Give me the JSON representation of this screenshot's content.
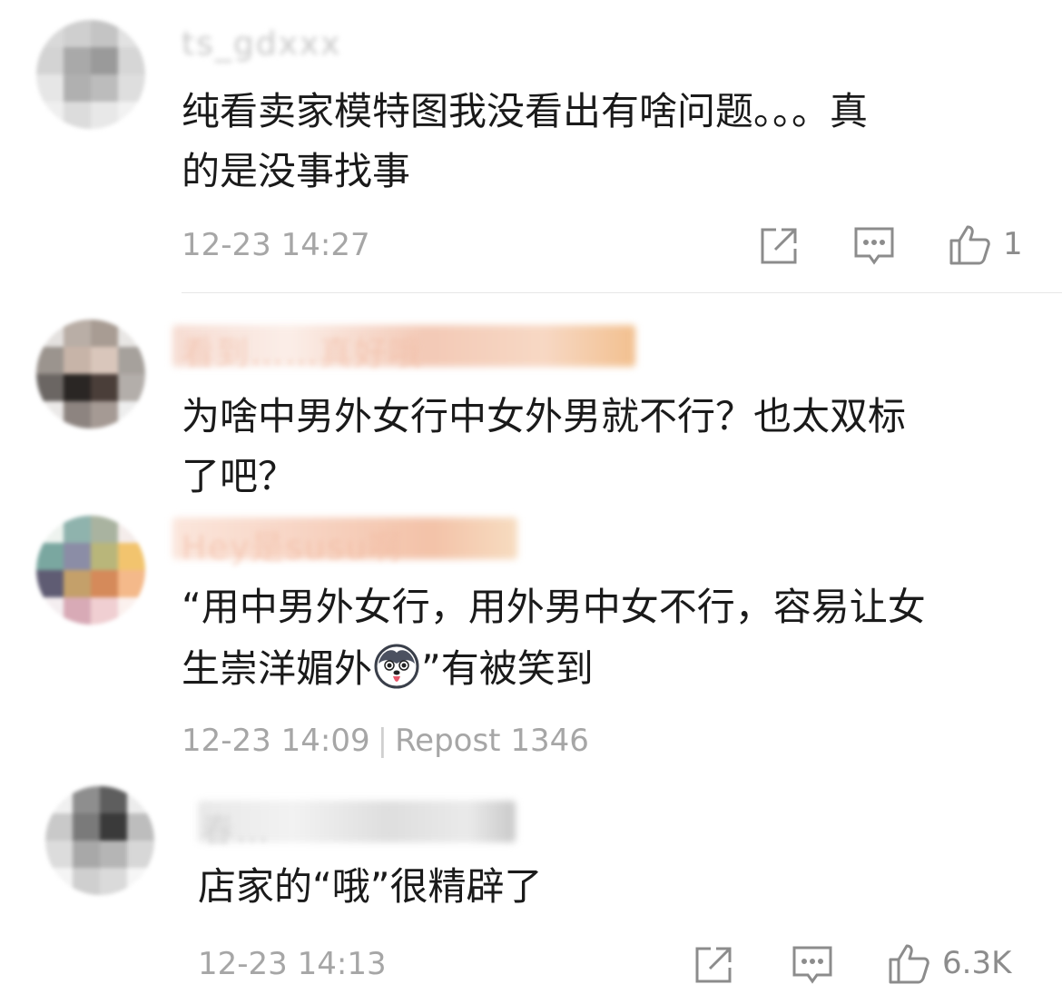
{
  "comments": [
    {
      "username": "ts_gdxxx",
      "text_lines": [
        "纯看卖家模特图我没看出有啥问题。。。真",
        "的是没事找事"
      ],
      "timestamp": "12-23 14:27",
      "like_count": "1",
      "icons": [
        "share-icon",
        "comment-icon",
        "like-icon"
      ]
    },
    {
      "username": "看到……真好哦",
      "text_lines": [
        "为啥中男外女行中女外男就不行？也太双标",
        "了吧？"
      ]
    },
    {
      "username": "Hey是susu啊",
      "text_lines": [
        "“用中男外女行，用外男中女不行，容易让女",
        "生崇洋媚外"
      ],
      "text_line2_suffix": "”有被笑到",
      "emoji": "husky-emoji",
      "timestamp": "12-23 14:09",
      "separator": "|",
      "repost_label": "Repost 1346"
    },
    {
      "username": "春…",
      "text_lines": [
        "店家的“哦”很精辟了"
      ],
      "timestamp": "12-23 14:13",
      "like_count": "6.3K",
      "icons": [
        "share-icon",
        "comment-icon",
        "like-icon"
      ]
    }
  ],
  "colors": {
    "text": "#1a1a1a",
    "meta": "#a6a6a6",
    "icon": "#8c8c8c",
    "divider": "#e6e6e6"
  }
}
